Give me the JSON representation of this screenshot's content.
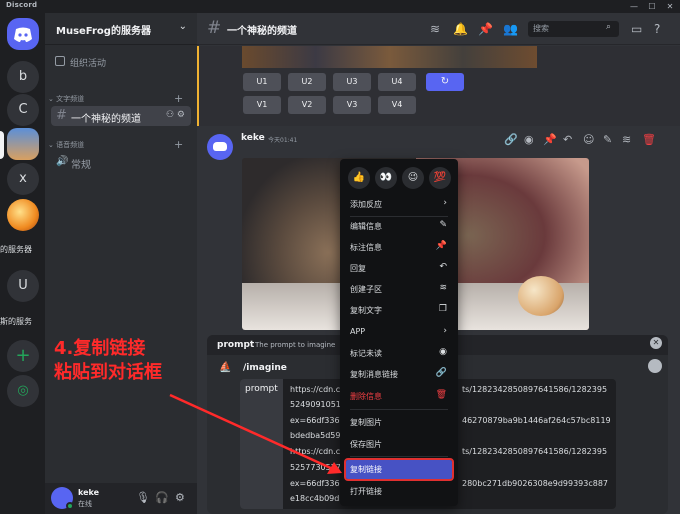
{
  "window": {
    "title": "Discord"
  },
  "servers": [
    {
      "letter": "b"
    },
    {
      "letter": "C"
    },
    {
      "letter": "x"
    },
    {
      "letter": "U"
    }
  ],
  "server_labels": {
    "label1": "的服务器",
    "label2": "斯的服务"
  },
  "sidebar": {
    "server_name": "MuseFrog的服务器",
    "event_label": "组织活动",
    "text_category": "文字频道",
    "active_channel": "一个神秘的频道",
    "voice_category": "语音频道",
    "voice_channel": "常规"
  },
  "user": {
    "name": "keke",
    "status": "在线"
  },
  "header": {
    "channel_title": "一个神秘的频道",
    "search_placeholder": "搜索"
  },
  "upscale_buttons": [
    "U1",
    "U2",
    "U3",
    "U4"
  ],
  "variation_buttons": [
    "V1",
    "V2",
    "V3",
    "V4"
  ],
  "message": {
    "author": "keke",
    "timestamp": "今天01:41"
  },
  "command": {
    "option_name": "prompt",
    "option_desc": "The prompt to imagine",
    "name": "/imagine",
    "prompt_label": "prompt",
    "lines": [
      "https://cdn.c",
      "5249091051",
      "ex=66df336",
      "bdedba5d59",
      "https://cdn.c",
      "5257730527",
      "ex=66df336",
      "e18cc4b09d"
    ],
    "lines_right": [
      "ts/1282342850897641586/1282395",
      "46270879ba9b1446af264c57bc8119",
      "ts/1282342850897641586/1282395",
      "280bc271db9026308e9d99393c887"
    ]
  },
  "context_menu": {
    "reactions": [
      "👍",
      "👀",
      "😉",
      "💯"
    ],
    "items": [
      {
        "label": "添加反应",
        "icon": "›"
      },
      {
        "label": "编辑信息",
        "icon": "✎"
      },
      {
        "label": "标注信息",
        "icon": "📌"
      },
      {
        "label": "回复",
        "icon": "↶"
      },
      {
        "label": "创建子区",
        "icon": "≋"
      },
      {
        "label": "复制文字",
        "icon": "❐"
      },
      {
        "label": "APP",
        "icon": "›"
      },
      {
        "label": "标记未读",
        "icon": "◉"
      },
      {
        "label": "复制消息链接",
        "icon": "🔗"
      },
      {
        "label": "删除信息",
        "icon": "🗑"
      },
      {
        "label": "复制图片",
        "icon": ""
      },
      {
        "label": "保存图片",
        "icon": ""
      },
      {
        "label": "复制链接",
        "icon": ""
      },
      {
        "label": "打开链接",
        "icon": ""
      }
    ]
  },
  "annotation": {
    "line1": "4.复制链接",
    "line2": "粘贴到对话框"
  },
  "colors": {
    "accent": "#5865f2",
    "danger": "#f23f43",
    "annotation": "#ff2a2a",
    "online": "#23a55a"
  }
}
